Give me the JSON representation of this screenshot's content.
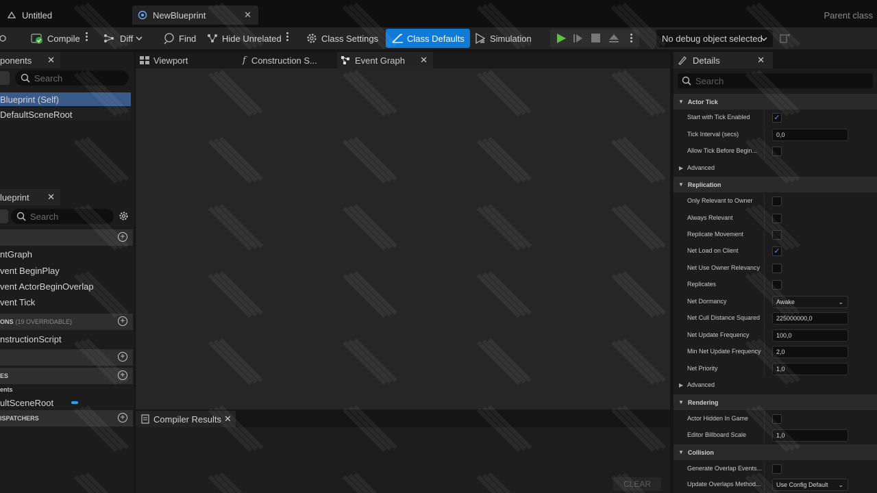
{
  "tabs": {
    "untitled": "Untitled",
    "blueprint": "NewBlueprint",
    "parent_class": "Parent class"
  },
  "toolbar": {
    "compile": "Compile",
    "diff": "Diff",
    "find": "Find",
    "hide_unrelated": "Hide Unrelated",
    "class_settings": "Class Settings",
    "class_defaults": "Class Defaults",
    "simulation": "Simulation",
    "debug_select": "No debug object selected"
  },
  "components": {
    "tab": "ponents",
    "search_placeholder": "Search",
    "items": [
      "Blueprint (Self)",
      "DefaultSceneRoot"
    ]
  },
  "my_blueprint": {
    "tab": "lueprint",
    "search_placeholder": "Search",
    "graphs": [
      "ntGraph",
      "vent BeginPlay",
      "vent ActorBeginOverlap",
      "vent Tick"
    ],
    "functions_header": "ONS",
    "functions_overridable": "(19 OVERRIDABLE)",
    "functions": [
      "nstructionScript"
    ],
    "variables_header": "ES",
    "variables_sub": "ents",
    "variables": [
      "ultSceneRoot"
    ],
    "dispatchers_header": "ISPATCHERS"
  },
  "center": {
    "viewport": "Viewport",
    "construction": "Construction S...",
    "event_graph": "Event Graph",
    "compiler_results": "Compiler Results",
    "clear": "CLEAR"
  },
  "details": {
    "tab": "Details",
    "search_placeholder": "Search",
    "actor_tick": {
      "title": "Actor Tick",
      "start_with_tick_enabled": "Start with Tick Enabled",
      "tick_interval_label": "Tick Interval (secs)",
      "tick_interval_value": "0,0",
      "allow_tick_before_begin": "Allow Tick Before Begin...",
      "advanced": "Advanced"
    },
    "replication": {
      "title": "Replication",
      "only_relevant_to_owner": "Only Relevant to Owner",
      "always_relevant": "Always Relevant",
      "replicate_movement": "Replicate Movement",
      "net_load_on_client": "Net Load on Client",
      "net_use_owner_relevancy": "Net Use Owner Relevancy",
      "replicates": "Replicates",
      "net_dormancy_label": "Net Dormancy",
      "net_dormancy_value": "Awake",
      "net_cull_label": "Net Cull Distance Squared",
      "net_cull_value": "225000000,0",
      "net_update_freq_label": "Net Update Frequency",
      "net_update_freq_value": "100,0",
      "min_net_update_freq_label": "Min Net Update Frequency",
      "min_net_update_freq_value": "2,0",
      "net_priority_label": "Net Priority",
      "net_priority_value": "1,0",
      "advanced": "Advanced"
    },
    "rendering": {
      "title": "Rendering",
      "actor_hidden_in_game": "Actor Hidden In Game",
      "editor_billboard_label": "Editor Billboard Scale",
      "editor_billboard_value": "1,0"
    },
    "collision": {
      "title": "Collision",
      "generate_overlap": "Generate Overlap Events...",
      "update_overlaps_label": "Update Overlaps Method...",
      "update_overlaps_value": "Use Config Default"
    }
  },
  "colors": {
    "accent": "#0f7bd9",
    "checkbox": "#3fa0ff",
    "play": "#5cc63b"
  }
}
